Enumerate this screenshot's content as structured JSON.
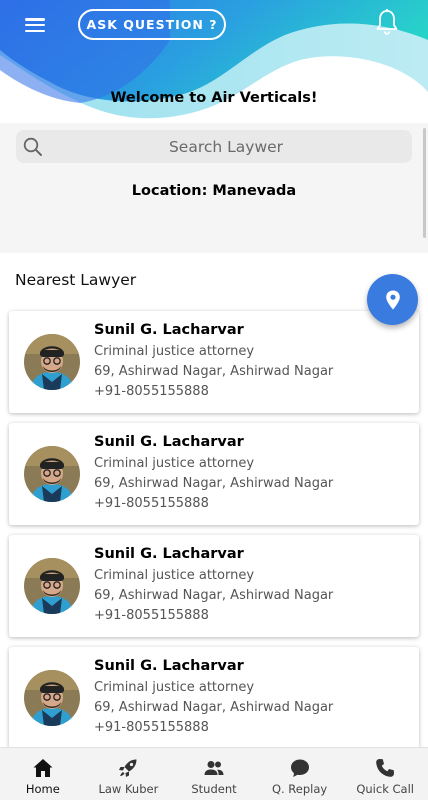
{
  "header": {
    "ask_button": "ASK QUESTION ?",
    "welcome": "Welcome to Air Verticals!"
  },
  "search": {
    "placeholder": "Search Laywer"
  },
  "location": "Location: Manevada",
  "section_title": "Nearest Lawyer",
  "lawyers": [
    {
      "name": "Sunil G. Lacharvar",
      "role": "Criminal justice attorney",
      "address": "69, Ashirwad Nagar, Ashirwad Nagar",
      "phone": "+91-8055155888"
    },
    {
      "name": "Sunil G. Lacharvar",
      "role": "Criminal justice attorney",
      "address": "69, Ashirwad Nagar, Ashirwad Nagar",
      "phone": "+91-8055155888"
    },
    {
      "name": "Sunil G. Lacharvar",
      "role": "Criminal justice attorney",
      "address": "69, Ashirwad Nagar, Ashirwad Nagar",
      "phone": "+91-8055155888"
    },
    {
      "name": "Sunil G. Lacharvar",
      "role": "Criminal justice attorney",
      "address": "69, Ashirwad Nagar, Ashirwad Nagar",
      "phone": "+91-8055155888"
    }
  ],
  "nav": [
    {
      "label": "Home",
      "icon": "home-icon",
      "active": true
    },
    {
      "label": "Law Kuber",
      "icon": "rocket-icon",
      "active": false
    },
    {
      "label": "Student",
      "icon": "people-icon",
      "active": false
    },
    {
      "label": "Q. Replay",
      "icon": "chat-icon",
      "active": false
    },
    {
      "label": "Quick Call",
      "icon": "phone-icon",
      "active": false
    }
  ],
  "colors": {
    "gradient_start": "#2f6fe8",
    "gradient_end": "#27d3c9",
    "fab": "#3a7be0",
    "nav_background": "#f3f3f3"
  }
}
